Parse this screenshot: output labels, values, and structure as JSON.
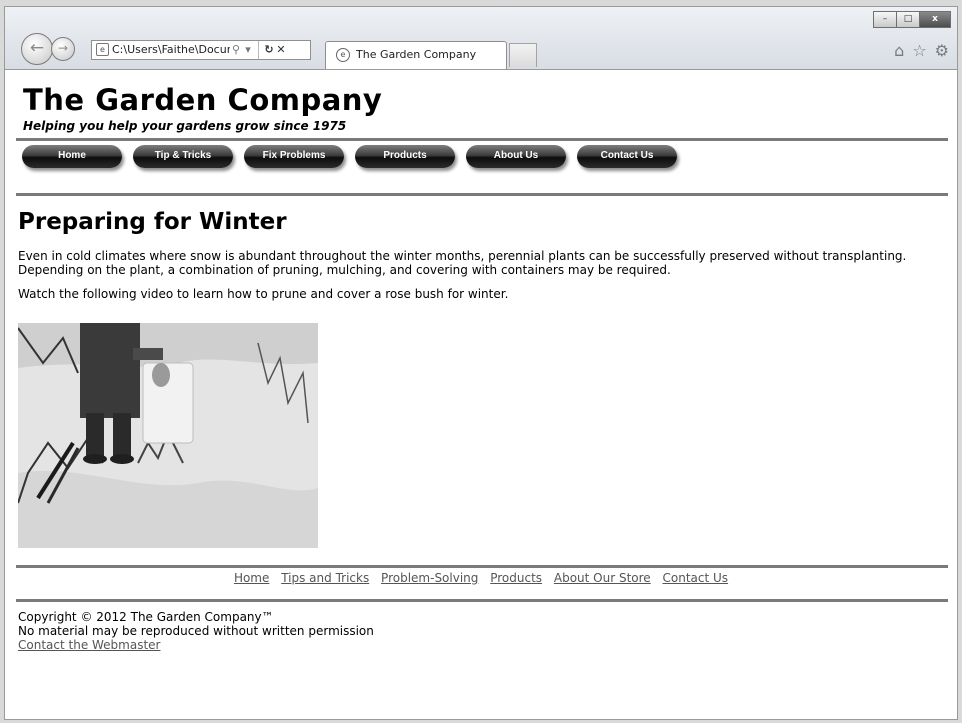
{
  "browser": {
    "address": "C:\\Users\\Faithe\\Docum",
    "tab_title": "The Garden Company",
    "window_buttons": [
      "–",
      "□",
      "x"
    ],
    "icons": [
      "home-icon",
      "star-icon",
      "gear-icon"
    ]
  },
  "site": {
    "title": "The Garden Company",
    "tagline": "Helping you help your gardens grow since 1975"
  },
  "nav": [
    "Home",
    "Tip & Tricks",
    "Fix Problems",
    "Products",
    "About Us",
    "Contact Us"
  ],
  "main": {
    "heading": "Preparing for Winter",
    "paragraph1": "Even in cold climates where snow is abundant throughout the winter months, perennial plants can be successfully preserved without transplanting. Depending on the plant, a combination of pruning, mulching, and covering with containers may be required.",
    "paragraph2": "Watch the following video to learn how to prune and cover a rose bush for winter."
  },
  "footer": {
    "links": [
      "Home",
      "Tips and Tricks",
      "Problem-Solving",
      "Products",
      "About Our Store",
      "Contact Us"
    ],
    "copyright": "Copyright © 2012 The Garden Company™",
    "notice": "No material may be reproduced without written permission",
    "webmaster": "Contact the Webmaster"
  }
}
